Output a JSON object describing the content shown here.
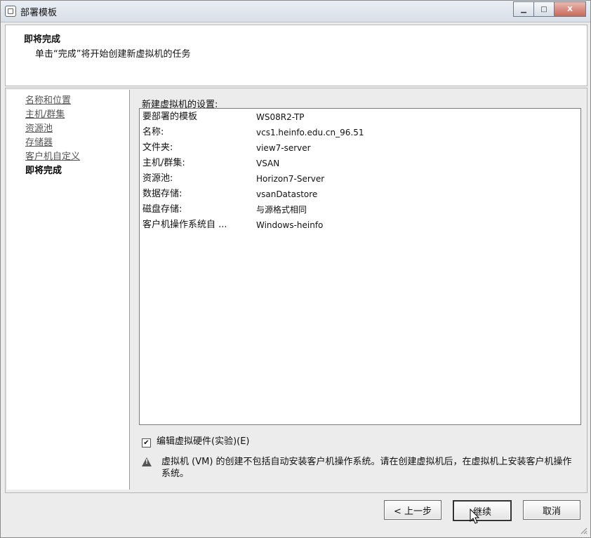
{
  "window": {
    "title": "部署模板",
    "minimize_icon": "minimize-icon",
    "maximize_icon": "maximize-icon",
    "close_icon": "close-icon",
    "close_label": "X"
  },
  "header": {
    "title": "即将完成",
    "subtitle": "单击“完成”将开始创建新虚拟机的任务"
  },
  "nav": {
    "items": [
      {
        "label": "名称和位置"
      },
      {
        "label": "主机/群集"
      },
      {
        "label": "资源池"
      },
      {
        "label": "存储器"
      },
      {
        "label": "客户机自定义"
      },
      {
        "label": "即将完成"
      }
    ],
    "active_index": 5
  },
  "settings": {
    "label": "新建虚拟机的设置:",
    "rows": [
      {
        "key": "要部署的模板",
        "value": "WS08R2-TP"
      },
      {
        "key": "名称:",
        "value": "vcs1.heinfo.edu.cn_96.51"
      },
      {
        "key": "文件夹:",
        "value": "view7-server"
      },
      {
        "key": "主机/群集:",
        "value": "VSAN"
      },
      {
        "key": "资源池:",
        "value": "Horizon7-Server"
      },
      {
        "key": "数据存储:",
        "value": "vsanDatastore"
      },
      {
        "key": "磁盘存储:",
        "value": "与源格式相同"
      },
      {
        "key": "客户机操作系统自 ...",
        "value": "Windows-heinfo"
      }
    ]
  },
  "options": {
    "edit_hardware_label": "编辑虚拟硬件(实验)(E)",
    "edit_hardware_checked": true
  },
  "warning": {
    "icon": "warning-icon",
    "text": "虚拟机 (VM) 的创建不包括自动安装客户机操作系统。请在创建虚拟机后，在虚拟机上安装客户机操作系统。"
  },
  "buttons": {
    "back": "< 上一步",
    "continue": "继续",
    "cancel": "取消"
  },
  "colors": {
    "titlebar": "#dde3ea",
    "close_button": "#c9685a",
    "panel_bg": "#ffffff"
  }
}
